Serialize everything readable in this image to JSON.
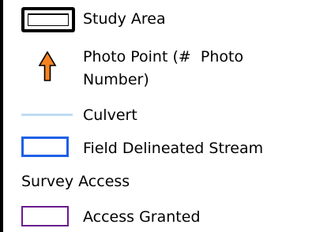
{
  "legend": {
    "items": [
      {
        "label": "Study Area",
        "icon": "study-area-frame",
        "color": "#000000"
      },
      {
        "label_lines": [
          "Photo Point (#  Photo",
          "Number)"
        ],
        "icon": "up-arrow-icon",
        "color": "#f58220"
      },
      {
        "label": "Culvert",
        "icon": "culvert-line",
        "color": "#bfdcf3"
      },
      {
        "label": "Field Delineated Stream",
        "icon": "stream-box",
        "color": "#1f5fe6"
      }
    ],
    "section_title": "Survey Access",
    "access_item": {
      "label": "Access Granted",
      "icon": "access-box",
      "color": "#6a1b8e"
    }
  }
}
